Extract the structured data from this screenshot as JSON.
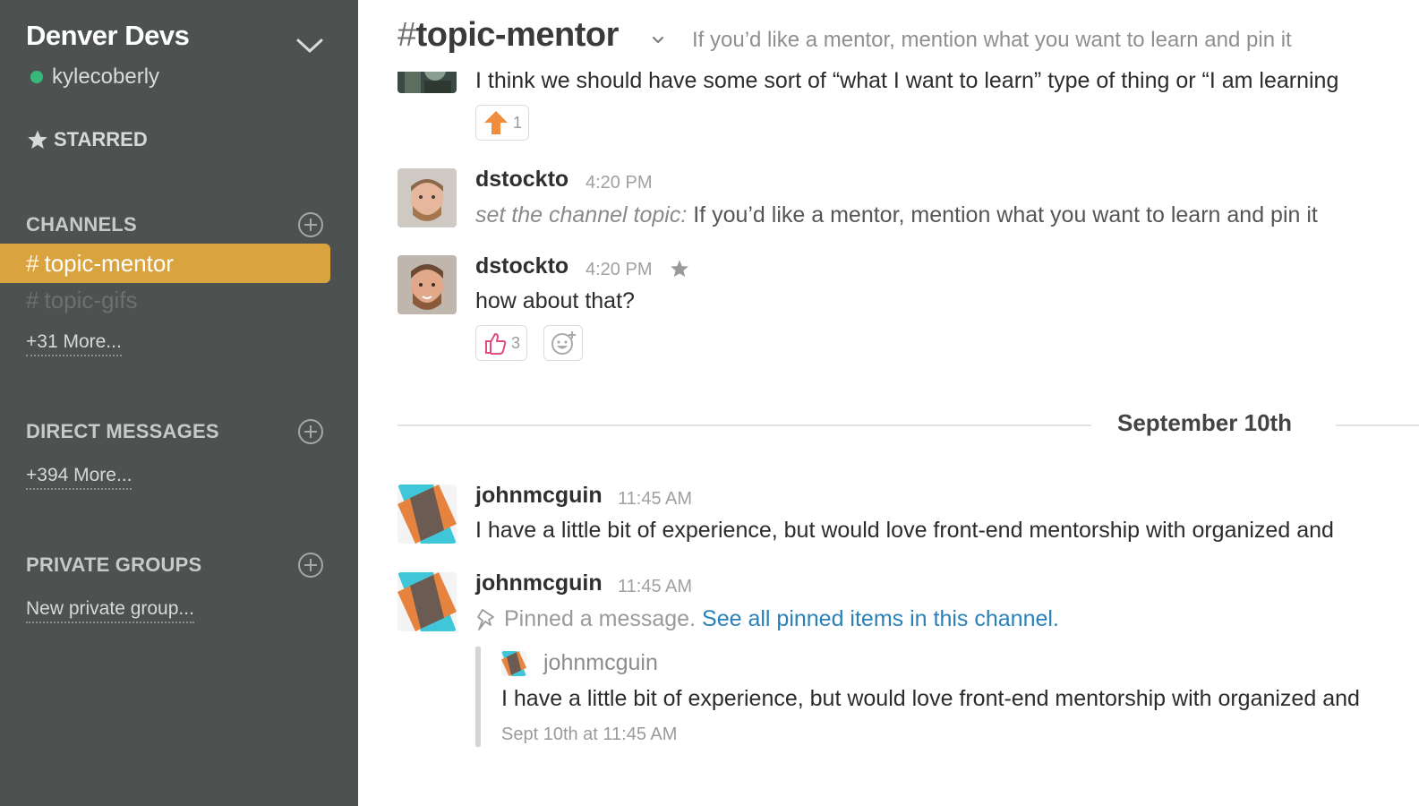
{
  "sidebar": {
    "team_name": "Denver Devs",
    "user_name": "kylecoberly",
    "presence_color": "#38b87c",
    "starred_label": "STARRED",
    "channels_header": "CHANNELS",
    "channels": [
      {
        "hash": "#",
        "name": "topic-mentor",
        "active": true
      },
      {
        "hash": "#",
        "name": "topic-gifs",
        "active": false
      }
    ],
    "channels_more": "+31 More...",
    "dm_header": "DIRECT MESSAGES",
    "dm_more": "+394 More...",
    "groups_header": "PRIVATE GROUPS",
    "groups_new": "New private group..."
  },
  "header": {
    "hash": "#",
    "channel_name": "topic-mentor",
    "topic": "If you’d like a mentor, mention what you want to learn and pin it"
  },
  "messages": [
    {
      "body": "I think we should have some sort of “what I want to learn” type of thing or “I am learning",
      "reaction": {
        "icon": "up-arrow-icon",
        "count": "1"
      }
    },
    {
      "author": "dstockto",
      "time": "4:20 PM",
      "topic_prefix": "set the channel topic:",
      "topic_body": "If you’d like a mentor, mention what you want to learn and pin it"
    },
    {
      "author": "dstockto",
      "time": "4:20 PM",
      "body": "how about that?",
      "reaction": {
        "icon": "thumbs-up-icon",
        "count": "3"
      }
    }
  ],
  "date_divider": "September 10th",
  "later_messages": [
    {
      "author": "johnmcguin",
      "time": "11:45 AM",
      "body": "I have a little bit of experience, but would love front-end mentorship with organized and"
    },
    {
      "author": "johnmcguin",
      "time": "11:45 AM",
      "pinned_text": "Pinned a message.",
      "pinned_link": "See all pinned items in this channel.",
      "quote": {
        "author": "johnmcguin",
        "body": "I have a little bit of experience, but would love front-end mentorship with organized and",
        "timestamp": "Sept 10th at 11:45 AM"
      }
    }
  ],
  "colors": {
    "sidebar_bg": "#4d5250",
    "active_channel": "#d9a340",
    "link": "#2a80b9"
  }
}
